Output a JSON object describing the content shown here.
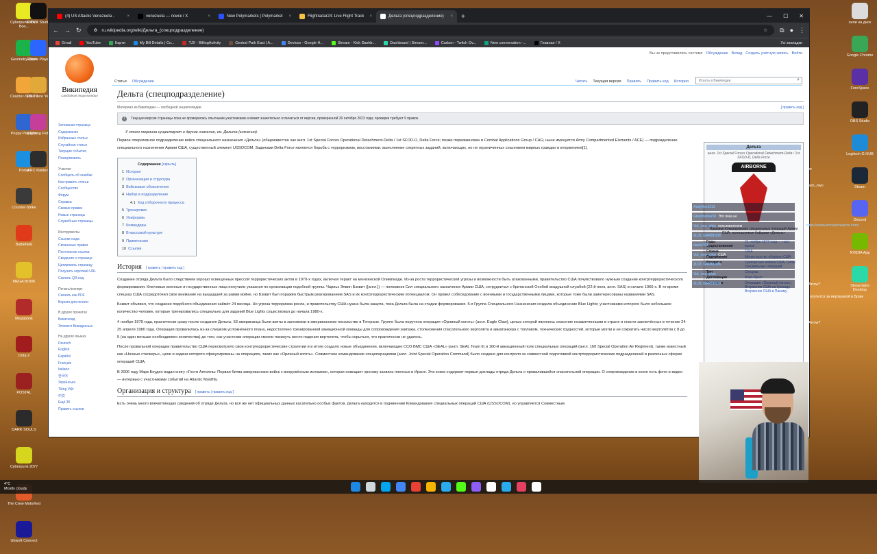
{
  "desktop_left": [
    {
      "label": "Cyberpunk 2077 Boo...",
      "color": "#e8e823"
    },
    {
      "label": "Geometry Dash",
      "color": "#1bb24a"
    },
    {
      "label": "Counter-Strike 2",
      "color": "#f2a63a"
    },
    {
      "label": "Poppy Playtime",
      "color": "#2e67d1"
    },
    {
      "label": "Portal",
      "color": "#1b8fe0"
    },
    {
      "label": "Counter-Strike",
      "color": "#3a3a3a"
    },
    {
      "label": "Battlefield",
      "color": "#e03a1b"
    },
    {
      "label": "MEGA BONK",
      "color": "#e2c12a"
    },
    {
      "label": "Megabonk",
      "color": "#b22b2b"
    },
    {
      "label": "Dota 2",
      "color": "#a11c1c"
    },
    {
      "label": "POSTAL",
      "color": "#9b2020"
    },
    {
      "label": "DARK SOULS",
      "color": "#2b2b2b"
    },
    {
      "label": "Cyberpunk 2077",
      "color": "#d6d61f"
    },
    {
      "label": "The Crew Motorfest",
      "color": "#e05a2a"
    },
    {
      "label": "Ubisoft Connect",
      "color": "#1a1a99"
    }
  ],
  "desktop_left2": [
    {
      "label": "Roblox Studio",
      "color": "#111111"
    },
    {
      "label": "Roblox Player",
      "color": "#2a66ff"
    },
    {
      "label": "RV There Yet",
      "color": "#e0a93a"
    },
    {
      "label": "Fighting Fish",
      "color": "#c53e9a"
    },
    {
      "label": "ARC Raiders",
      "color": "#2d2d2d"
    }
  ],
  "desktop_right": [
    {
      "label": "сили на диск",
      "color": "#dcdcdc"
    },
    {
      "label": "Google Chrome",
      "color": "#3aa757"
    },
    {
      "label": "ForeSpace",
      "color": "#5b2fa6"
    },
    {
      "label": "OBS Studio",
      "color": "#222222"
    },
    {
      "label": "Logitech G HUB",
      "color": "#1e8bd6"
    },
    {
      "label": "Steam",
      "color": "#1b2838"
    },
    {
      "label": "Discord",
      "color": "#5865f2"
    },
    {
      "label": "NVIDIA App",
      "color": "#76b900"
    },
    {
      "label": "Streamlabs Desktop",
      "color": "#2bd9a8"
    }
  ],
  "browser": {
    "tabs": [
      {
        "title": "(4) US Attacks Venezuela -",
        "color": "#ff0000"
      },
      {
        "title": "venezuela — поиск / X",
        "color": "#000000"
      },
      {
        "title": "New Polymarkets | Polymarket",
        "color": "#2b52ff"
      },
      {
        "title": "Flightradar24: Live Flight Track",
        "color": "#f6c343"
      },
      {
        "title": "Дельта (спецподразделение)",
        "color": "#ffffff"
      }
    ],
    "url": "ru.wikipedia.org/wiki/Дельта_(спецподразделение)",
    "bookmarks": [
      {
        "label": "Gmail",
        "color": "#ea4335"
      },
      {
        "label": "YouTube",
        "color": "#ff0000"
      },
      {
        "label": "Карти",
        "color": "#34a853"
      },
      {
        "label": "My Bill Details | Co...",
        "color": "#1e88e5"
      },
      {
        "label": "TJX - BillingActivity",
        "color": "#c62828"
      },
      {
        "label": "Central Park East | A...",
        "color": "#6d4c41"
      },
      {
        "label": "Devices - Google H...",
        "color": "#4285f4"
      },
      {
        "label": "Stream - Kick Dashb...",
        "color": "#53fc18"
      },
      {
        "label": "Dashboard | Stream...",
        "color": "#2bd9a8"
      },
      {
        "label": "Carbon - Twitch Ov...",
        "color": "#9146ff"
      },
      {
        "label": "New conversation -...",
        "color": "#10a37f"
      },
      {
        "label": "Главная / X",
        "color": "#000000"
      }
    ],
    "bookmarks_more": "Усі закладки"
  },
  "wiki": {
    "wordmark": "Википедия",
    "tagline": "Свободная энциклопедия",
    "personal": [
      "Вы не представились системе",
      "Обсуждение",
      "Вклад",
      "Создать учётную запись",
      "Войти"
    ],
    "sidebar": [
      {
        "type": "item",
        "label": "Заглавная страница"
      },
      {
        "type": "item",
        "label": "Содержание"
      },
      {
        "type": "item",
        "label": "Избранные статьи"
      },
      {
        "type": "item",
        "label": "Случайная статья"
      },
      {
        "type": "item",
        "label": "Текущие события"
      },
      {
        "type": "item",
        "label": "Пожертвовать"
      },
      {
        "type": "sec",
        "label": "Участие"
      },
      {
        "type": "item",
        "label": "Сообщить об ошибке"
      },
      {
        "type": "item",
        "label": "Как править статьи"
      },
      {
        "type": "item",
        "label": "Сообщество"
      },
      {
        "type": "item",
        "label": "Форум"
      },
      {
        "type": "item",
        "label": "Справка"
      },
      {
        "type": "item",
        "label": "Свежие правки"
      },
      {
        "type": "item",
        "label": "Новые страницы"
      },
      {
        "type": "item",
        "label": "Служебные страницы"
      },
      {
        "type": "sec",
        "label": "Инструменты"
      },
      {
        "type": "item",
        "label": "Ссылки сюда"
      },
      {
        "type": "item",
        "label": "Связанные правки"
      },
      {
        "type": "item",
        "label": "Постоянная ссылка"
      },
      {
        "type": "item",
        "label": "Сведения о странице"
      },
      {
        "type": "item",
        "label": "Цитировать страницу"
      },
      {
        "type": "item",
        "label": "Получить короткий URL"
      },
      {
        "type": "item",
        "label": "Скачать QR-код"
      },
      {
        "type": "sec",
        "label": "Печать/экспорт"
      },
      {
        "type": "item",
        "label": "Скачать как PDF"
      },
      {
        "type": "item",
        "label": "Версия для печати"
      },
      {
        "type": "sec",
        "label": "В других проектах"
      },
      {
        "type": "item",
        "label": "Викисклад"
      },
      {
        "type": "item",
        "label": "Элемент Викиданных"
      },
      {
        "type": "sec",
        "label": "На других языках"
      },
      {
        "type": "item",
        "label": "Deutsch"
      },
      {
        "type": "item",
        "label": "English"
      },
      {
        "type": "item",
        "label": "Español"
      },
      {
        "type": "item",
        "label": "Français"
      },
      {
        "type": "item",
        "label": "Italiano"
      },
      {
        "type": "item",
        "label": "한국어"
      },
      {
        "type": "item",
        "label": "Українська"
      },
      {
        "type": "item",
        "label": "Tiếng Việt"
      },
      {
        "type": "item",
        "label": "中文"
      },
      {
        "type": "item",
        "label": "Ещё 30"
      },
      {
        "type": "item",
        "label": "Править ссылки"
      }
    ],
    "tabs_left": [
      "Статья",
      "Обсуждение"
    ],
    "tabs_right": [
      "Читать",
      "Текущая версия",
      "Править",
      "Править код",
      "История"
    ],
    "search_placeholder": "Искать в Википедии",
    "title": "Дельта (спецподразделение)",
    "sitesub": "Материал из Википедии — свободной энциклопедии",
    "edit_code": "[ править код ]",
    "notice": "Текущая версия страницы пока не проверялась опытными участниками и может значительно отличаться от версии, проверенной 20 октября 2023 года; проверки требуют 9 правок.",
    "hatnote": "У этого термина существуют и другие значения, см. Дельта (значения).",
    "lead": "Первое оперативное подразделение войск специального назначения «Дельта» (общеизвестен как англ. 1st Special Forces Operational Detachment-Delta / 1st SFOD-D, Delta Force; позже переименован в Combat Applications Group / CAG; ныне именуется Army Compartmented Elements / ACE) — подразделение специального назначения Армии США, существенный элемент USSOCOM. Задачами Delta Force являются борьба с терроризмом, восстаниями, выполнение секретных заданий, включающих, но не ограниченных спасением мирных граждан и вторжением[1].",
    "toc": {
      "title": "Содержание",
      "toggle": "[скрыть]",
      "entries": [
        {
          "n": "1",
          "t": "История",
          "sub": false
        },
        {
          "n": "2",
          "t": "Организация и структура",
          "sub": false
        },
        {
          "n": "3",
          "t": "Войсковые обозначения",
          "sub": false
        },
        {
          "n": "4",
          "t": "Набор в подразделение",
          "sub": false
        },
        {
          "n": "4.1",
          "t": "Ход отборочного процесса",
          "sub": true
        },
        {
          "n": "5",
          "t": "Тренировки",
          "sub": false
        },
        {
          "n": "6",
          "t": "Униформа",
          "sub": false
        },
        {
          "n": "7",
          "t": "Командиры",
          "sub": false
        },
        {
          "n": "8",
          "t": "В массовой культуре",
          "sub": false
        },
        {
          "n": "9",
          "t": "Примечания",
          "sub": false
        },
        {
          "n": "10",
          "t": "Ссылки",
          "sub": false
        }
      ]
    },
    "history_heading": "История",
    "history_edit": "[ править | править код ]",
    "history_paras": [
      "Создание отряда Дельта было следствием хорошо освещённых прессой террористических актов в 1970-х годах, включая теракт на мюнхенской Олимпиаде. Из-за роста террористической угрозы и возможности быть атакованными, правительство США почувствовало нужным создание контртеррористического формирования. Ключевые военные и государственные лица получили указания по организации подобной группы. Чарльз Элвин Бэквит ([англ.]) — полковник Сил специального назначения Армии США, сотрудничал с британской Особой воздушной службой (22-й полк, англ. SAS) в начале 1960-х. В то время спецназ США сосредоточил свое внимание на выщедшей за рамки войне, но Бэквит был поражён быстрым реагированием SAS и их контртеррористическим потенциалом. Он провел собеседование с военными и государственными лицами, которые тоже были заинтересованы названиями SAS.",
      "Бэквит объявил, что создание подобного объединения займёт 24 месяца. Но угроза терроризма росла, и правительству США нужна была защита, пока Дельта была на стадии формирования. 5-я Группа Специального Назначения создала объединение Blue Lights; участниками которого было небольшое количество человек, которые тренировались специально для заданий Blue Lights существовал до начала 1980-х.",
      "4 ноября 1979 года, практически сразу после создания Дельты, 53 американца были взяты в заложники в американском посольстве в Тегеране. Группе была поручена операция «Орлиный коготь» (англ. Eagle Claw), целью которой являлось спасение незамеченными в стране и спасти заключённых в течение 24-25 апреля 1980 года. Операция провалилась из-за слишком усложнённого плана, недостаточно тренированной авиационной команды для сопровождения экипажа, столкновения спасательного вертолёта и авиатанкера с топливом, технических трудностей, которые могли и не сократить число вертолётов с 8 до 5 (на один меньше необходимого количества) до того, как участники операции смогли покинуть место падения вертолета, чтобы скрыться, что практически не удалось.",
      "После провальной операции правительство США пересмотрело свои контртеррористические стратегии и в итоге создало новые объединения, включающие ССО ВМС США «SEAL» (англ. SEAL Team 6) и 160-й авиационный полк специальных операций (англ. 160 Special Operation Air Regiment), также известный как «Ночные сталкеры», цели и задачи которого сфокусированы на операциях, таких как «Орлиный коготь». Совместное командование спецоперациями (англ. Joint Special Operation Command) было создано для контроля за совместной подготовкой контртеррористических подразделений в различных сферах операций США.",
      "В 2006 году Марк Боуден издал книгу «Гости Аятоллы: Первая битва американских войск с вооружённым исламом», которая освещает хронику захвата пленных в Иране. Эта книга содержит первые доклады отряда Дельта о провалившейся спасательной операции. О сопровождении в книге есть фото и видео — интервью с участниками событий на Atlantic Monthly."
    ],
    "org_heading": "Организация и структура",
    "org_edit": "[ править | править код ]",
    "org_para": "Есть очень много впечатляющих сведений об отряде Дельта, но всё же нет официальных данных касательно особых фактов. Дельта находится в подчинении Командования специальных операций США (USSOCOM), но управляется Совместным",
    "infobox": {
      "title": "Дельта",
      "subtitle": "англ. 1st Special Forces Operational Detachment-Delta / 1st SFOD-D, Delta Force",
      "patch_text": "AIRBORNE",
      "caption": "Нашивка Командования специальных операций Армии США, используемая бойцами «Дельты»",
      "rows": [
        {
          "k": "Годы существования",
          "v": "21 ноября 1977 года — наст. время"
        },
        {
          "k": "Страна",
          "v": "США"
        },
        {
          "k": "Подчинение",
          "v": "Министерство обороны США"
        },
        {
          "k": "Входит в",
          "v": "Сухопутные войска США, Силы специальных операций"
        },
        {
          "k": "Тип",
          "v": "Спецназ"
        },
        {
          "k": "Дислокация",
          "v": "Форт-Брэгг"
        },
        {
          "k": "Участие в",
          "v": "Операция «Орлиный коготь», Вторжение США на Гренаду, Вторжение США в Панаму"
        }
      ]
    }
  },
  "chat": [
    {
      "user": "Andylive1312",
      "msg": ""
    },
    {
      "user": "Glowhunter10",
      "msg": "Это пока не"
    },
    {
      "user": "Vot_ono_chto",
      "msg": "пользователем"
    },
    {
      "user": "ZLOI_GARBUZIK",
      "msg": ""
    },
    {
      "user": "itachi753",
      "msg": ""
    },
    {
      "user": "Vot_ono_chto",
      "msg": "США"
    },
    {
      "user": "ZLOI_GARBUZIK",
      "msg": ""
    },
    {
      "user": "Vot_ono_chto",
      "msg": ""
    },
    {
      "user": "ZLOI_GARBUZIK",
      "msg": ""
    }
  ],
  "overlay_right": {
    "kash": "Kash_owo",
    "chat_label": "Чат",
    "donation": "https://www.donationalerts.com/",
    "arrow1": "Arrow?",
    "arrow2": "Arrow?",
    "hunt": "охотится за верхушкой в Брам",
    "kuri": "kuri"
  },
  "taskbar": {
    "weather_temp": "4°C",
    "weather_desc": "Mostly cloudy",
    "apps": [
      "#1e88e5",
      "#cfd8dc",
      "#00a4ef",
      "#4285f4",
      "#e94235",
      "#f6b400",
      "#2aabee",
      "#53fc18",
      "#8e5cf6",
      "#ffffff",
      "#2aabee",
      "#e4405f",
      "#ffffff"
    ]
  }
}
